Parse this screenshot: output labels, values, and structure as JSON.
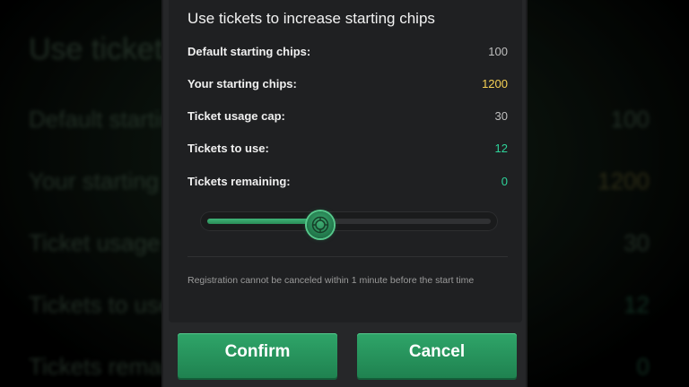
{
  "background": {
    "title": "Use tickets to increase starting chips",
    "rows": [
      {
        "label": "Default starting chips",
        "value": "100"
      },
      {
        "label": "Your starting chips",
        "value": "1200"
      },
      {
        "label": "Ticket usage cap",
        "value": "30"
      },
      {
        "label": "Tickets to use",
        "value": "12"
      },
      {
        "label": "Tickets remaining",
        "value": "0"
      }
    ]
  },
  "dialog": {
    "title": "Use tickets to increase starting chips",
    "rows": [
      {
        "label": "Default starting chips:",
        "value": "100"
      },
      {
        "label": "Your starting chips:",
        "value": "1200"
      },
      {
        "label": "Ticket usage cap:",
        "value": "30"
      },
      {
        "label": "Tickets to use:",
        "value": "12"
      },
      {
        "label": "Tickets remaining:",
        "value": "0"
      }
    ],
    "slider": {
      "min": 0,
      "max": 30,
      "value": 12,
      "thumb_icon": "chip-icon"
    },
    "notice": "Registration cannot be canceled within 1 minute before the start time",
    "confirm_label": "Confirm",
    "cancel_label": "Cancel"
  },
  "colors": {
    "accent_green": "#2a9a5e",
    "gold_value": "#f7d154",
    "teal_value": "#2ed39a",
    "panel_bg": "#1f2022"
  }
}
